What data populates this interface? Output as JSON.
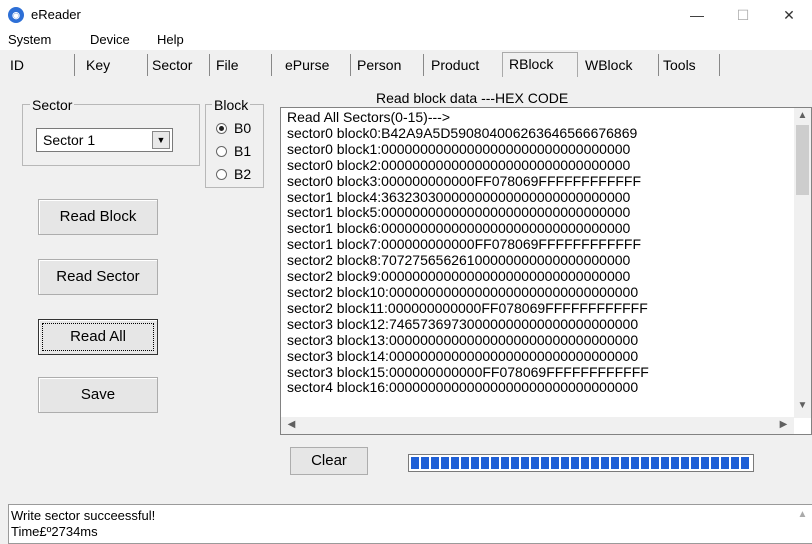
{
  "window": {
    "title": "eReader",
    "icon": "app-logo-icon",
    "controls": [
      "—",
      "☐",
      "✕"
    ]
  },
  "menu": [
    "System",
    "Device",
    "Help"
  ],
  "tabs": [
    "ID",
    "Key",
    "Sector",
    "File",
    "ePurse",
    "Person",
    "Product",
    "RBlock",
    "WBlock",
    "Tools"
  ],
  "active_tab": "RBlock",
  "sector_group": {
    "label": "Sector",
    "selected": "Sector 1"
  },
  "block_group": {
    "label": "Block",
    "options": [
      {
        "label": "B0",
        "checked": true
      },
      {
        "label": "B1",
        "checked": false
      },
      {
        "label": "B2",
        "checked": false
      }
    ]
  },
  "buttons": {
    "read_block": "Read Block",
    "read_sector": "Read Sector",
    "read_all": "Read All",
    "save": "Save",
    "clear": "Clear"
  },
  "hex": {
    "caption": "Read block data ---HEX CODE",
    "lines": [
      "Read All Sectors(0-15)--->",
      "sector0 block0:B42A9A5D590804006263646566676869",
      "sector0 block1:00000000000000000000000000000000",
      "sector0 block2:00000000000000000000000000000000",
      "sector0 block3:000000000000FF078069FFFFFFFFFFFF",
      "sector1 block4:36323030000000000000000000000000",
      "sector1 block5:00000000000000000000000000000000",
      "sector1 block6:00000000000000000000000000000000",
      "sector1 block7:000000000000FF078069FFFFFFFFFFFF",
      "sector2 block8:70727565626100000000000000000000",
      "sector2 block9:00000000000000000000000000000000",
      "sector2 block10:00000000000000000000000000000000",
      "sector2 block11:000000000000FF078069FFFFFFFFFFFF",
      "sector3 block12:74657369730000000000000000000000",
      "sector3 block13:00000000000000000000000000000000",
      "sector3 block14:00000000000000000000000000000000",
      "sector3 block15:000000000000FF078069FFFFFFFFFFFF",
      "sector4 block16:00000000000000000000000000000000"
    ]
  },
  "progress": {
    "fraction": 1.0,
    "color": "#1f5fd6"
  },
  "status": {
    "lines": [
      "Write sector succeessful!",
      "Time£º2734ms"
    ]
  }
}
